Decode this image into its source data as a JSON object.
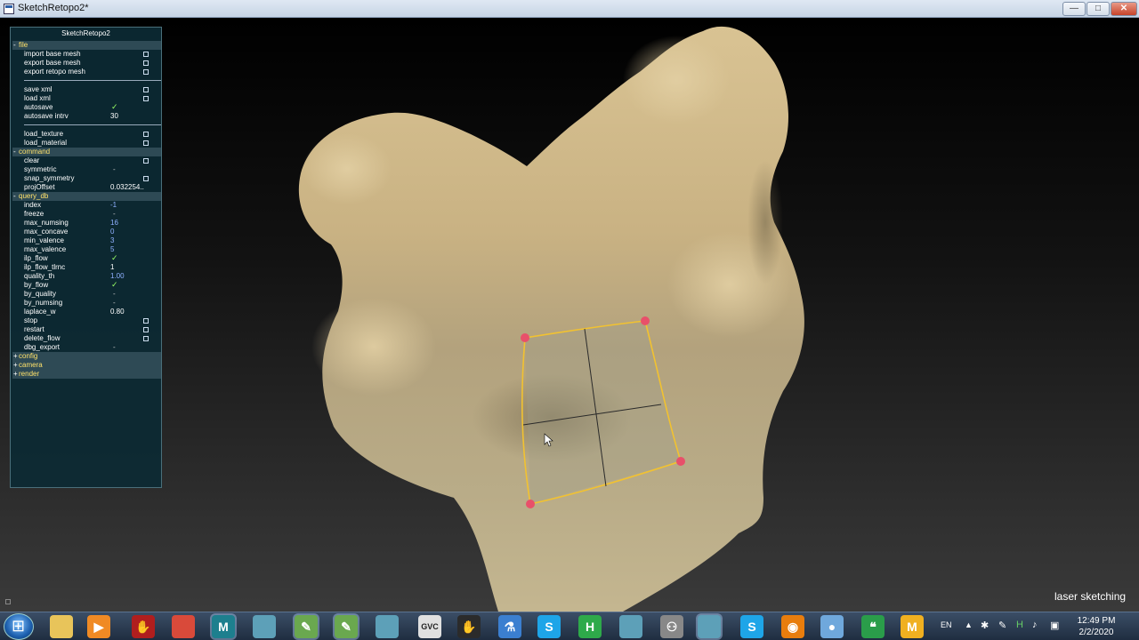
{
  "window": {
    "title": "SketchRetopo2*",
    "minimize": "—",
    "maximize": "□",
    "close": "✕"
  },
  "panel": {
    "title": "SketchRetopo2",
    "rows": [
      {
        "type": "section",
        "sign": "-",
        "label": "file"
      },
      {
        "type": "button",
        "label": "import base mesh"
      },
      {
        "type": "button",
        "label": "export base mesh"
      },
      {
        "type": "button",
        "label": "export retopo mesh"
      },
      {
        "type": "sep"
      },
      {
        "type": "button",
        "label": "save xml"
      },
      {
        "type": "button",
        "label": "load xml"
      },
      {
        "type": "check",
        "label": "autosave",
        "checked": true
      },
      {
        "type": "value",
        "label": "autosave intrv",
        "value": "30"
      },
      {
        "type": "sep"
      },
      {
        "type": "button",
        "label": "load_texture"
      },
      {
        "type": "button",
        "label": "load_material"
      },
      {
        "type": "section",
        "sign": "-",
        "label": "command"
      },
      {
        "type": "button",
        "label": "clear"
      },
      {
        "type": "check",
        "label": "symmetric",
        "checked": false
      },
      {
        "type": "button",
        "label": "snap_symmetry"
      },
      {
        "type": "value",
        "label": "projOffset",
        "value": "0.032254.."
      },
      {
        "type": "section",
        "sign": "-",
        "label": "query_db"
      },
      {
        "type": "value",
        "label": "index",
        "value": "-1",
        "blue": true
      },
      {
        "type": "check",
        "label": "freeze",
        "checked": false
      },
      {
        "type": "value",
        "label": "max_numsing",
        "value": "16",
        "blue": true
      },
      {
        "type": "value",
        "label": "max_concave",
        "value": "0",
        "blue": true
      },
      {
        "type": "value",
        "label": "min_valence",
        "value": "3",
        "blue": true
      },
      {
        "type": "value",
        "label": "max_valence",
        "value": "5",
        "blue": true
      },
      {
        "type": "check",
        "label": "ilp_flow",
        "checked": true
      },
      {
        "type": "value",
        "label": "ilp_flow_tlrnc",
        "value": "1"
      },
      {
        "type": "value",
        "label": "quality_th",
        "value": "1.00",
        "blue": true
      },
      {
        "type": "check",
        "label": "by_flow",
        "checked": true
      },
      {
        "type": "check",
        "label": "by_quality",
        "checked": false
      },
      {
        "type": "check",
        "label": "by_numsing",
        "checked": false
      },
      {
        "type": "value",
        "label": "laplace_w",
        "value": "0.80"
      },
      {
        "type": "button",
        "label": "stop"
      },
      {
        "type": "button",
        "label": "restart"
      },
      {
        "type": "button",
        "label": "delete_flow"
      },
      {
        "type": "check",
        "label": "dbg_export",
        "checked": false
      },
      {
        "type": "section",
        "sign": "+",
        "label": "config"
      },
      {
        "type": "section",
        "sign": "+",
        "label": "camera"
      },
      {
        "type": "section",
        "sign": "+",
        "label": "render"
      }
    ]
  },
  "status_text": "laser sketching",
  "colors": {
    "mesh_light": "#d8c59a",
    "mesh_dark": "#8a7a58",
    "patch_outline": "#f2c230",
    "patch_vertex": "#e8506a",
    "panel_bg": "#0c2a34",
    "section_label": "#ffe26b"
  },
  "taskbar": {
    "icons": [
      {
        "name": "explorer-icon",
        "glyph": "",
        "color": "#e8c45a"
      },
      {
        "name": "media-player-icon",
        "glyph": "▶",
        "color": "#f08a24"
      },
      {
        "name": "app-red-icon",
        "glyph": "✋",
        "color": "#b01e1e"
      },
      {
        "name": "chrome-icon",
        "glyph": "",
        "color": "#d94a3a"
      },
      {
        "name": "maya-icon",
        "glyph": "M",
        "color": "#1d7f8e"
      },
      {
        "name": "window-icon-1",
        "glyph": "",
        "color": "#5da0b8"
      },
      {
        "name": "notepad-icon-1",
        "glyph": "✎",
        "color": "#6aa84f"
      },
      {
        "name": "notepad-icon-2",
        "glyph": "✎",
        "color": "#6aa84f"
      },
      {
        "name": "window-icon-2",
        "glyph": "",
        "color": "#5da0b8"
      },
      {
        "name": "gvc-icon",
        "glyph": "GVC",
        "color": "#e0e0e0"
      },
      {
        "name": "houdini-hand-icon",
        "glyph": "✋",
        "color": "#2b2b2b"
      },
      {
        "name": "flask-icon",
        "glyph": "⚗",
        "color": "#3b7fd0"
      },
      {
        "name": "skype-icon-1",
        "glyph": "S",
        "color": "#1ea5e8"
      },
      {
        "name": "h-app-icon",
        "glyph": "H",
        "color": "#2eaa4a"
      },
      {
        "name": "window-icon-3",
        "glyph": "",
        "color": "#5da0b8"
      },
      {
        "name": "people-icon",
        "glyph": "⚇",
        "color": "#888"
      },
      {
        "name": "window-icon-4",
        "glyph": "",
        "color": "#5da0b8"
      },
      {
        "name": "skype-icon-2",
        "glyph": "S",
        "color": "#1ea5e8"
      },
      {
        "name": "blender-icon",
        "glyph": "◉",
        "color": "#e87d0d"
      },
      {
        "name": "circle-app-icon",
        "glyph": "●",
        "color": "#6fa8dc"
      },
      {
        "name": "hangouts-icon",
        "glyph": "❝",
        "color": "#2a9d4a"
      },
      {
        "name": "m-app-icon",
        "glyph": "M",
        "color": "#f0b020"
      }
    ],
    "lang": "EN",
    "time": "12:49 PM",
    "date": "2/2/2020"
  }
}
